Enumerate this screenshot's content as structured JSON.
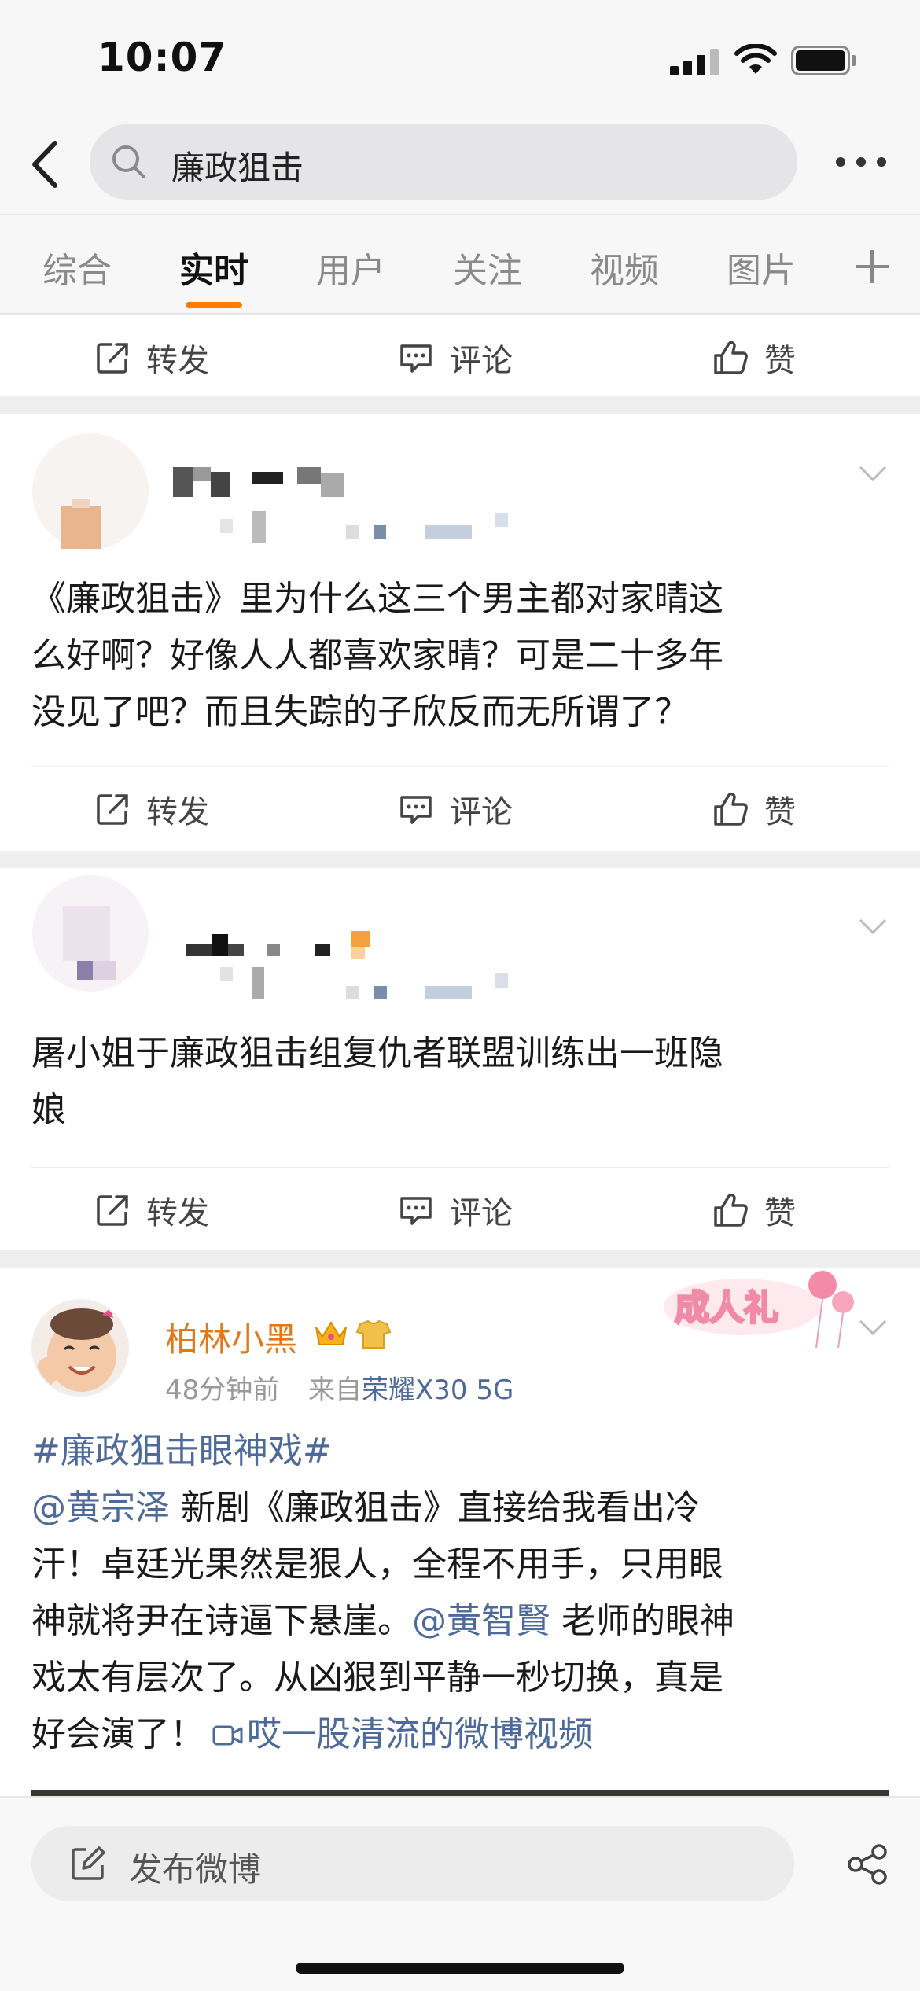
{
  "status_bar": {
    "time": "10:07"
  },
  "search": {
    "query": "廉政狙击"
  },
  "tabs": [
    {
      "label": "综合"
    },
    {
      "label": "实时"
    },
    {
      "label": "用户"
    },
    {
      "label": "关注"
    },
    {
      "label": "视频"
    },
    {
      "label": "图片"
    }
  ],
  "actions": {
    "repost": "转发",
    "comment": "评论",
    "like": "赞"
  },
  "posts": [
    {
      "text_lines": [
        "《廉政狙击》里为什么这三个男主都对家晴这",
        "么好啊？好像人人都喜欢家晴？可是二十多年",
        "没见了吧？而且失踪的子欣反而无所谓了？"
      ]
    },
    {
      "text_lines": [
        "屠小姐于廉政狙击组复仇者联盟训练出一班隐",
        "娘"
      ]
    },
    {
      "username": "柏林小黑",
      "time": "48分钟前",
      "source_prefix": "来自",
      "source_device": "荣耀X30 5G",
      "badge_text": "成人礼",
      "hashtag": "#廉政狙击眼神戏#",
      "mention1": "@黄宗泽",
      "line1_rest": " 新剧《廉政狙击》直接给我看出冷",
      "line2": "汗！卓廷光果然是狠人，全程不用手，只用眼",
      "line3_start": "神就将尹在诗逼下悬崖。",
      "mention2": "@黃智賢",
      "line3_rest": " 老师的眼神",
      "line4": "戏太有层次了。从凶狠到平静一秒切换，真是",
      "line5_start": "好会演了！",
      "video_link": "哎一股清流的微博视频"
    }
  ],
  "composer": {
    "placeholder": "发布微博"
  },
  "colors": {
    "accent": "#ff7a00",
    "link": "#4d6a9a",
    "username": "#e1791c"
  }
}
